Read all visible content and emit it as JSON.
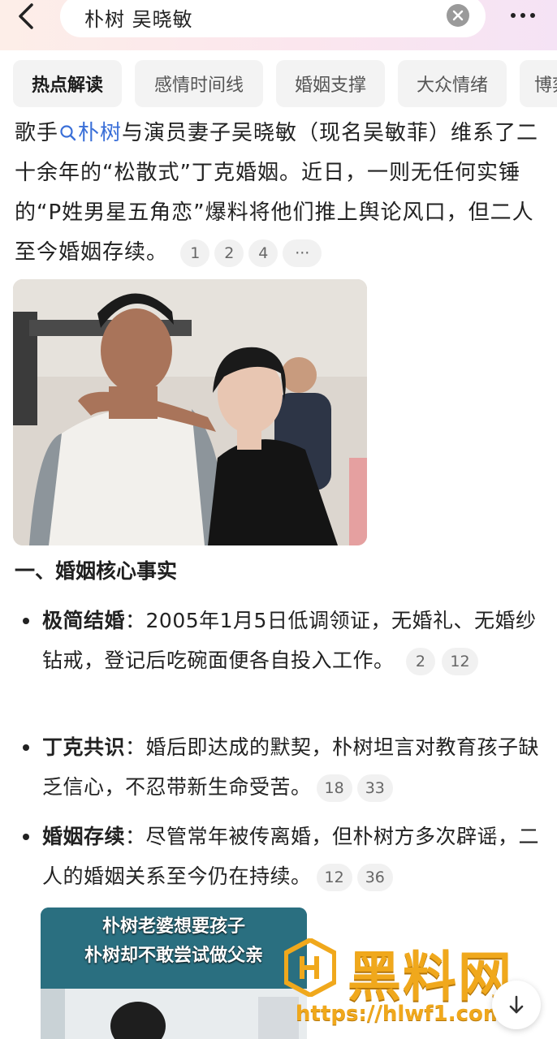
{
  "search": {
    "query": "朴树 吴晓敏"
  },
  "tabs": [
    "热点解读",
    "感情时间线",
    "婚姻支撑",
    "大众情绪",
    "博弈"
  ],
  "intro": {
    "prefix": "歌手",
    "link": "朴树",
    "rest": "与演员妻子吴晓敏（现名吴敏菲）维系了二十余年的“松散式”丁克婚姻。近日，一则无任何实锤的“P姓男星五角恋”爆料将他们推上舆论风口，但二人至今婚姻存续。",
    "refs": [
      "1",
      "2",
      "4",
      "···"
    ]
  },
  "section": {
    "title": "一、婚姻核心事实"
  },
  "bullets": [
    {
      "term": "极简结婚",
      "colon": "：",
      "text": "2005年1月5日低调领证，无婚礼、无婚纱钻戒，登记后吃碗面便各自投入工作。",
      "refs": [
        "2",
        "12"
      ]
    },
    {
      "term": "丁克共识",
      "colon": "：",
      "text": "婚后即达成的默契，朴树坦言对教育孩子缺乏信心，不忍带新生命受苦。",
      "refs": [
        "18",
        "33"
      ]
    },
    {
      "term": "婚姻存续",
      "colon": "：",
      "text": "尽管常年被传离婚，但朴树方多次辟谣，二人的婚姻关系至今仍在持续。",
      "refs": [
        "12",
        "36"
      ]
    }
  ],
  "video": {
    "caption_line1": "朴树老婆想要孩子",
    "caption_line2": "朴树却不敢尝试做父亲"
  },
  "watermark": {
    "text": "黑料网",
    "url": "https://hlwf1.com"
  },
  "colors": {
    "accent": "#3a6fd8",
    "watermark": "#f0a81c"
  }
}
